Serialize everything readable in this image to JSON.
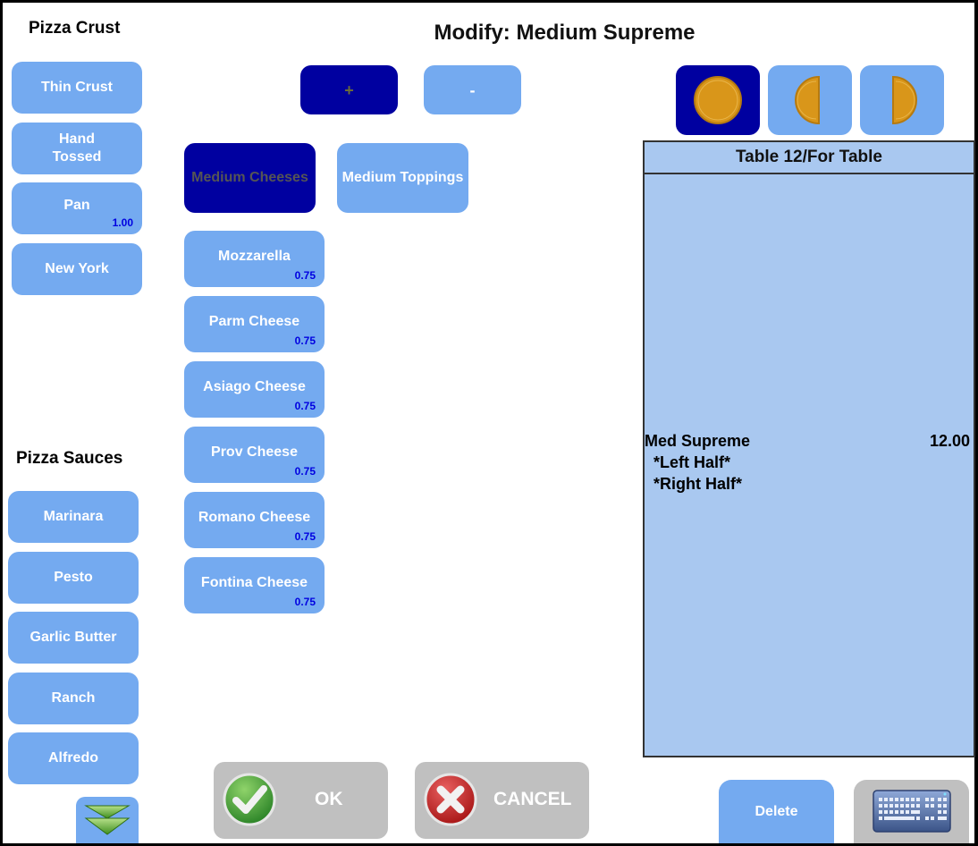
{
  "header": {
    "title": "Modify: Medium Supreme"
  },
  "crust": {
    "title": "Pizza Crust",
    "items": [
      {
        "label": "Thin Crust",
        "price": ""
      },
      {
        "label": "Hand\nTossed",
        "price": ""
      },
      {
        "label": "Pan",
        "price": "1.00"
      },
      {
        "label": "New York",
        "price": ""
      }
    ]
  },
  "sauces": {
    "title": "Pizza Sauces",
    "items": [
      {
        "label": "Marinara"
      },
      {
        "label": "Pesto"
      },
      {
        "label": "Garlic Butter"
      },
      {
        "label": "Ranch"
      },
      {
        "label": "Alfredo"
      }
    ],
    "scroll_down_icon": "double-chevron-down-icon"
  },
  "quantity": {
    "plus_label": "+",
    "minus_label": "-"
  },
  "categories": [
    {
      "label": "Medium Cheeses",
      "active": true
    },
    {
      "label": "Medium Toppings",
      "active": false
    }
  ],
  "cheeses": [
    {
      "label": "Mozzarella",
      "price": "0.75"
    },
    {
      "label": "Parm Cheese",
      "price": "0.75"
    },
    {
      "label": "Asiago Cheese",
      "price": "0.75"
    },
    {
      "label": "Prov Cheese",
      "price": "0.75"
    },
    {
      "label": "Romano Cheese",
      "price": "0.75"
    },
    {
      "label": "Fontina Cheese",
      "price": "0.75"
    }
  ],
  "portion": {
    "options": [
      {
        "icon": "whole-pizza-icon",
        "active": true
      },
      {
        "icon": "left-half-pizza-icon",
        "active": false
      },
      {
        "icon": "right-half-pizza-icon",
        "active": false
      }
    ]
  },
  "check": {
    "header": "Table 12/For Table",
    "item": {
      "name": "Med Supreme",
      "price": "12.00"
    },
    "modifiers": [
      "*Left Half*",
      "*Right Half*"
    ]
  },
  "actions": {
    "ok_label": "OK",
    "cancel_label": "CANCEL",
    "delete_label": "Delete",
    "keyboard_icon": "keyboard-icon"
  },
  "colors": {
    "button": "#74aaf0",
    "button_active": "#0000a0",
    "price_text": "#0000e0",
    "check_bg": "#a9c8f0",
    "gray_button": "#c0c0c0"
  }
}
